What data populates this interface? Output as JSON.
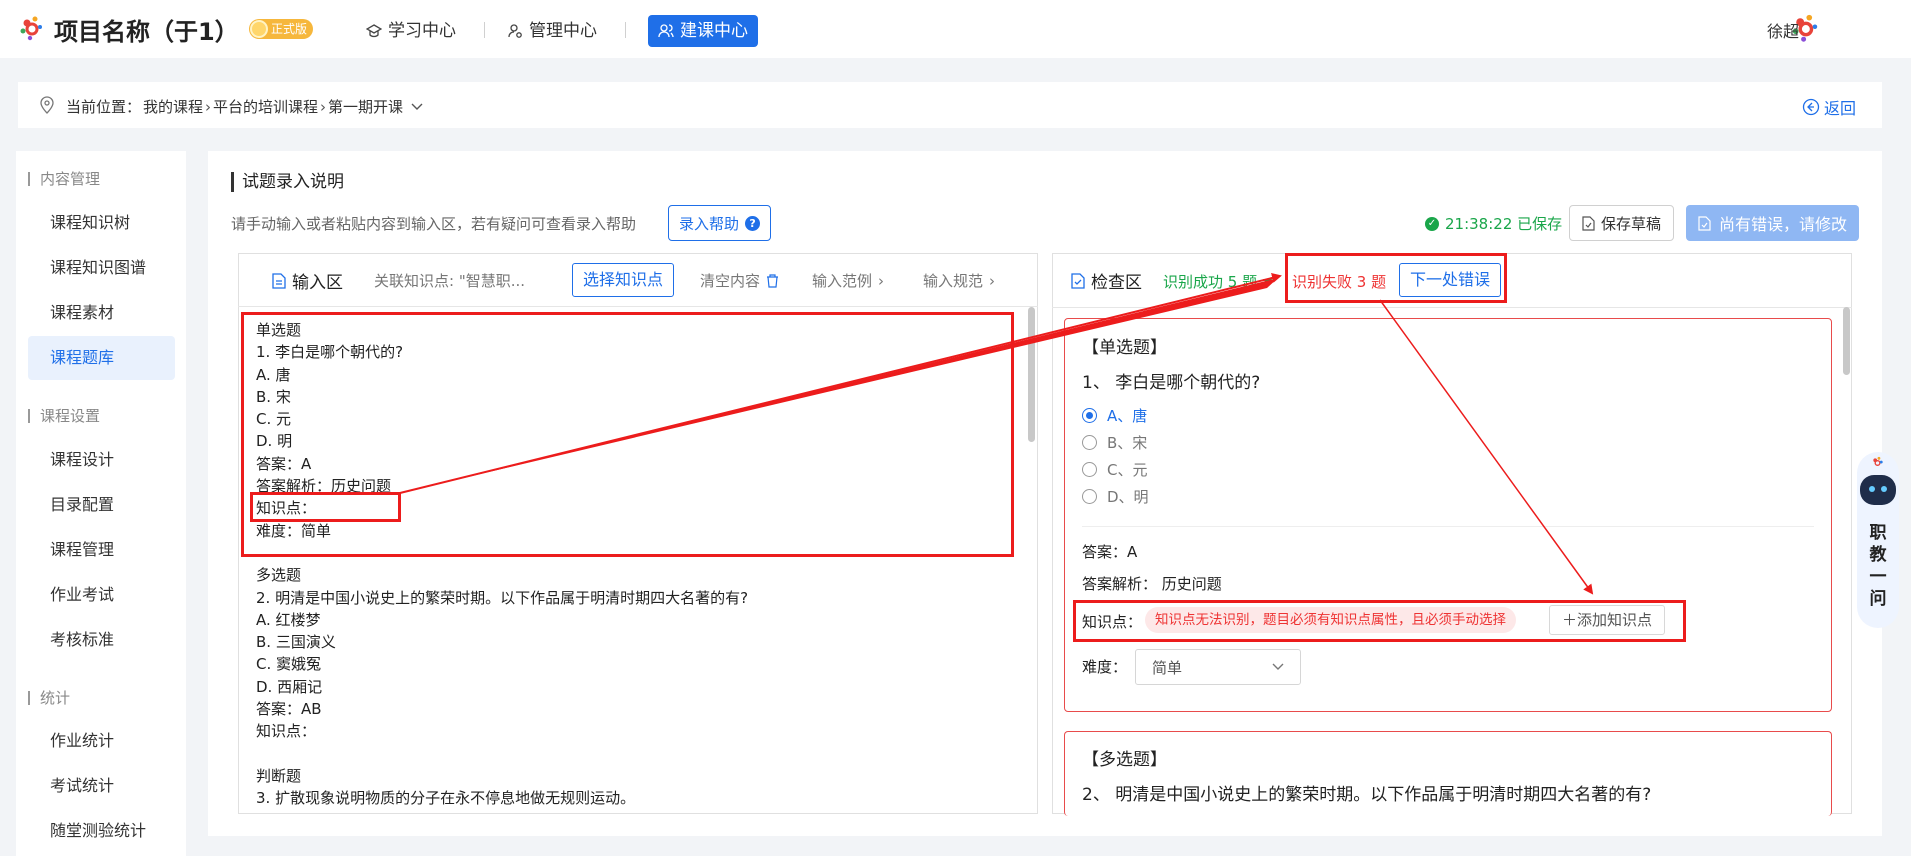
{
  "header": {
    "project_title": "项目名称（于1）",
    "badge": "正式版",
    "nav": [
      {
        "label": "学习中心",
        "icon": "graduation-cap-icon",
        "active": false
      },
      {
        "label": "管理中心",
        "icon": "user-settings-icon",
        "active": false
      },
      {
        "label": "建课中心",
        "icon": "users-icon",
        "active": true
      }
    ],
    "user_name": "徐超"
  },
  "breadcrumb": {
    "prefix": "当前位置：",
    "items": [
      "我的课程",
      "平台的培训课程",
      "第一期开课"
    ],
    "back_label": "返回"
  },
  "sidebar": {
    "groups": [
      {
        "title": "内容管理",
        "items": [
          "课程知识树",
          "课程知识图谱",
          "课程素材",
          "课程题库"
        ]
      },
      {
        "title": "课程设置",
        "items": [
          "课程设计",
          "目录配置",
          "课程管理",
          "作业考试",
          "考核标准"
        ]
      },
      {
        "title": "统计",
        "items": [
          "作业统计",
          "考试统计",
          "随堂测验统计"
        ]
      }
    ],
    "active_item": "课程题库"
  },
  "main": {
    "section_title": "试题录入说明",
    "instructions": "请手动输入或者粘贴内容到输入区，若有疑问可查看录入帮助",
    "help_button": "录入帮助",
    "saved_status": "21:38:22 已保存",
    "save_draft": "保存草稿",
    "error_button": "尚有错误，请修改"
  },
  "input_area": {
    "title": "输入区",
    "linked_kp": "关联知识点: \"智慧职...",
    "choose_kp": "选择知识点",
    "clear": "清空内容",
    "example": "输入范例",
    "spec": "输入规范",
    "content": "单选题\n1. 李白是哪个朝代的?\nA. 唐\nB. 宋\nC. 元\nD. 明\n答案：A\n答案解析：历史问题\n知识点：\n难度：简单\n\n多选题\n2. 明清是中国小说史上的繁荣时期。以下作品属于明清时期四大名著的有?\nA. 红楼梦\nB. 三国演义\nC. 窦娥冤\nD. 西厢记\n答案：AB\n知识点：\n\n判断题\n3. 扩散现象说明物质的分子在永不停息地做无规则运动。"
  },
  "check_area": {
    "title": "检查区",
    "success": "识别成功 5 题",
    "fail": "识别失败 3 题",
    "next_error": "下一处错误",
    "q1": {
      "type": "【单选题】",
      "stem": "1、 李白是哪个朝代的?",
      "options": [
        {
          "label": "A、唐",
          "selected": true
        },
        {
          "label": "B、宋",
          "selected": false
        },
        {
          "label": "C、元",
          "selected": false
        },
        {
          "label": "D、明",
          "selected": false
        }
      ],
      "answer": "答案：A",
      "analysis": "答案解析：  历史问题",
      "kp_label": "知识点：",
      "kp_warning": "知识点无法识别，题目必须有知识点属性，且必须手动选择",
      "add_kp": "添加知识点",
      "difficulty_label": "难度：",
      "difficulty_value": "简单"
    },
    "q2": {
      "type": "【多选题】",
      "stem": "2、 明清是中国小说史上的繁荣时期。以下作品属于明清时期四大名著的有?"
    }
  },
  "floating_widget": {
    "text": "职教一问"
  },
  "colors": {
    "primary": "#1f6fe8",
    "success": "#1aa64a",
    "error": "#e33333",
    "annotation": "#ec1c1c"
  }
}
